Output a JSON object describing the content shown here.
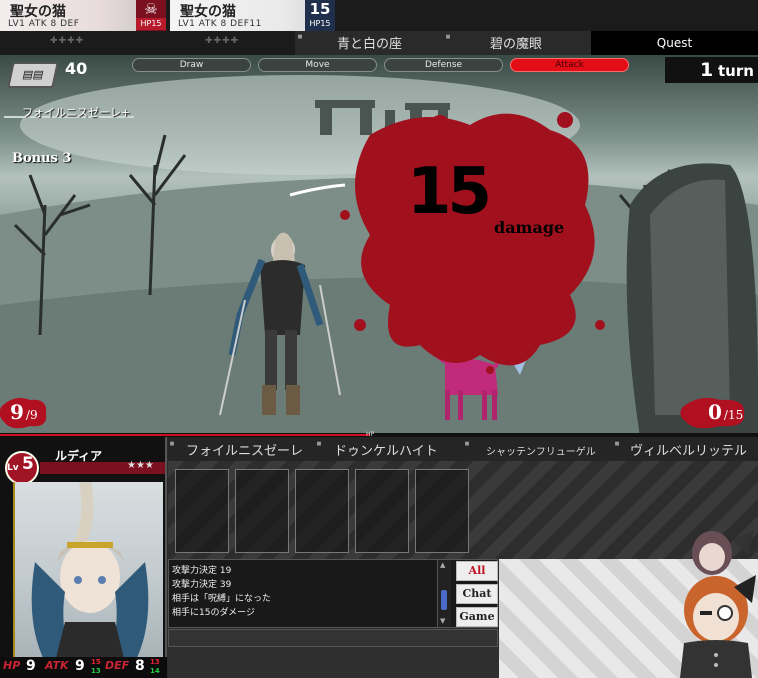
{
  "player1": {
    "name": "聖女の猫",
    "stats": "LV1 ATK 8 DEF",
    "hp_label": "HP15"
  },
  "player2": {
    "name": "聖女の猫",
    "stats": "LV1 ATK 8 DEF11",
    "hp_value": "15",
    "hp_label": "HP15"
  },
  "zones": {
    "left": "青と白の座",
    "right": "碧の魔眼"
  },
  "quest": {
    "label": "Quest"
  },
  "phases": [
    "Draw",
    "Move",
    "Defense",
    "Attack"
  ],
  "active_phase": "Attack",
  "turn": {
    "number": "1",
    "label": "turn"
  },
  "deck": {
    "count": "40"
  },
  "skill": {
    "name": "フォイルニスゼーレ+"
  },
  "bonus": {
    "label": "Bonus 3"
  },
  "damage": {
    "value": "15",
    "label": "damage"
  },
  "hp_left": {
    "current": "9",
    "max": "9"
  },
  "hp_right": {
    "current": "0",
    "max": "15"
  },
  "hp_bar_label": "HP",
  "character": {
    "name": "ルディア",
    "level": "5",
    "level_label": "Lv",
    "stars": "★★★",
    "hp_label": "HP",
    "hp": "9",
    "atk_label": "ATK",
    "atk": "9",
    "atk_bonus_top": "15",
    "atk_bonus_bottom": "13",
    "def_label": "DEF",
    "def": "8",
    "def_bonus_top": "13",
    "def_bonus_bottom": "14"
  },
  "card_tabs": [
    "フォイルニスゼーレ",
    "ドゥンケルハイト",
    "シャッテンフリューゲル",
    "ヴィルベルリッテル"
  ],
  "log": [
    "攻撃力決定 19",
    "攻撃力決定 39",
    "相手は「呪縛」になった",
    "相手に15のダメージ"
  ],
  "log_tabs": [
    "All",
    "Chat",
    "Game"
  ],
  "colors": {
    "accent_red": "#e30d18",
    "dark_red": "#7a1020",
    "navy": "#1f2f4c"
  }
}
